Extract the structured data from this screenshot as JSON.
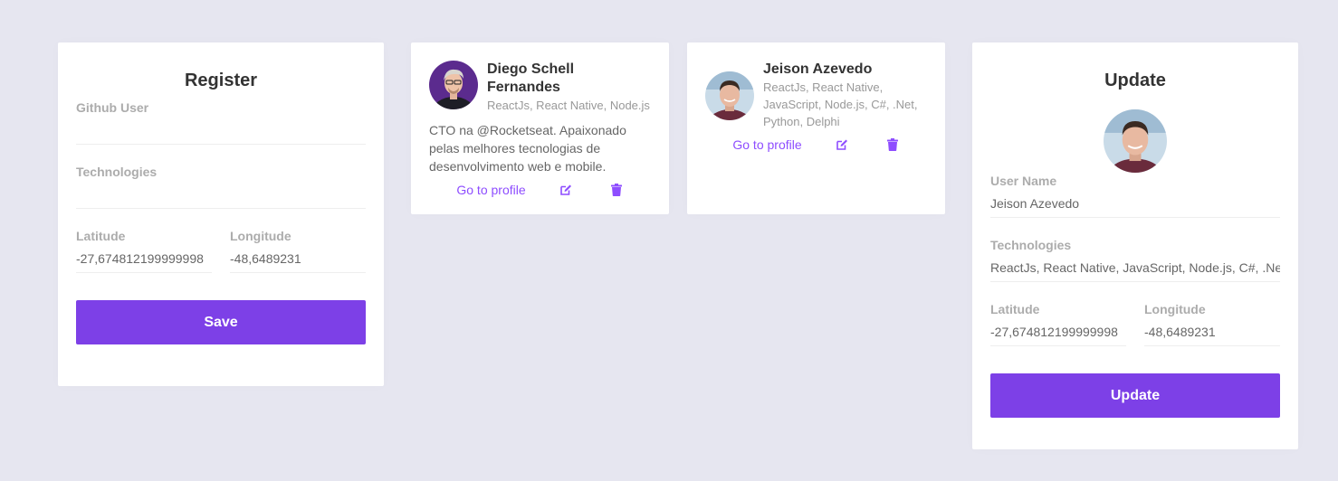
{
  "register": {
    "title": "Register",
    "github_user_label": "Github User",
    "github_user_value": "",
    "technologies_label": "Technologies",
    "technologies_value": "",
    "latitude_label": "Latitude",
    "latitude_value": "-27,674812199999998",
    "longitude_label": "Longitude",
    "longitude_value": "-48,6489231",
    "save_label": "Save"
  },
  "devs": [
    {
      "name": "Diego Schell Fernandes",
      "techs": "ReactJs, React Native, Node.js",
      "bio": "CTO na @Rocketseat. Apaixonado pelas melhores tecnologias de desenvolvimento web e mobile.",
      "profile_label": "Go to profile"
    },
    {
      "name": "Jeison Azevedo",
      "techs": "ReactJs, React Native, JavaScript, Node.js, C#, .Net, Python, Delphi",
      "bio": "",
      "profile_label": "Go to profile"
    }
  ],
  "update": {
    "title": "Update",
    "user_name_label": "User Name",
    "user_name_value": "Jeison Azevedo",
    "technologies_label": "Technologies",
    "technologies_value": "ReactJs, React Native, JavaScript, Node.js, C#, .Net, Python, Delphi",
    "latitude_label": "Latitude",
    "latitude_value": "-27,674812199999998",
    "longitude_label": "Longitude",
    "longitude_value": "-48,6489231",
    "update_label": "Update"
  },
  "icons": {
    "edit": "edit-icon",
    "trash": "trash-icon"
  },
  "colors": {
    "accent": "#7d40e7",
    "link": "#8e4dff",
    "background": "#e6e6f0"
  }
}
